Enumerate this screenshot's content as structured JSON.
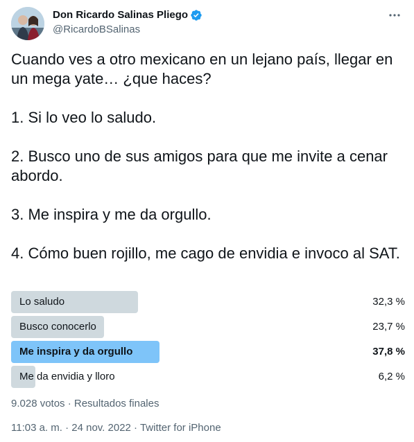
{
  "author": {
    "display_name": "Don Ricardo Salinas Pliego",
    "handle": "@RicardoBSalinas",
    "verified": true
  },
  "tweet": {
    "paragraphs": [
      "Cuando ves a otro mexicano en un lejano país, llegar en un mega yate… ¿que haces?",
      "1. Si lo veo lo saludo.",
      "2. Busco uno de sus amigos para que me invite a cenar abordo.",
      "3. Me inspira y me da orgullo.",
      "4. Cómo buen rojillo, me cago de envidia e invoco al SAT."
    ]
  },
  "poll": {
    "options": [
      {
        "label": "Lo saludo",
        "percent_text": "32,3 %",
        "percent": 32.3,
        "winner": false
      },
      {
        "label": "Busco conocerlo",
        "percent_text": "23,7 %",
        "percent": 23.7,
        "winner": false
      },
      {
        "label": "Me inspira y da orgullo",
        "percent_text": "37,8 %",
        "percent": 37.8,
        "winner": true
      },
      {
        "label": "Me da envidia y lloro",
        "percent_text": "6,2 %",
        "percent": 6.2,
        "winner": false
      }
    ],
    "meta": "9.028 votos · Resultados finales"
  },
  "timestamp": "11:03 a. m. · 24 nov. 2022 · Twitter for iPhone",
  "colors": {
    "bar": "#cfd9de",
    "winner_bar": "#7ec4f9",
    "verified": "#1d9bf0",
    "secondary_text": "#536471"
  },
  "icons": [
    "avatar-photo",
    "verified-badge-icon",
    "more-options-icon"
  ]
}
